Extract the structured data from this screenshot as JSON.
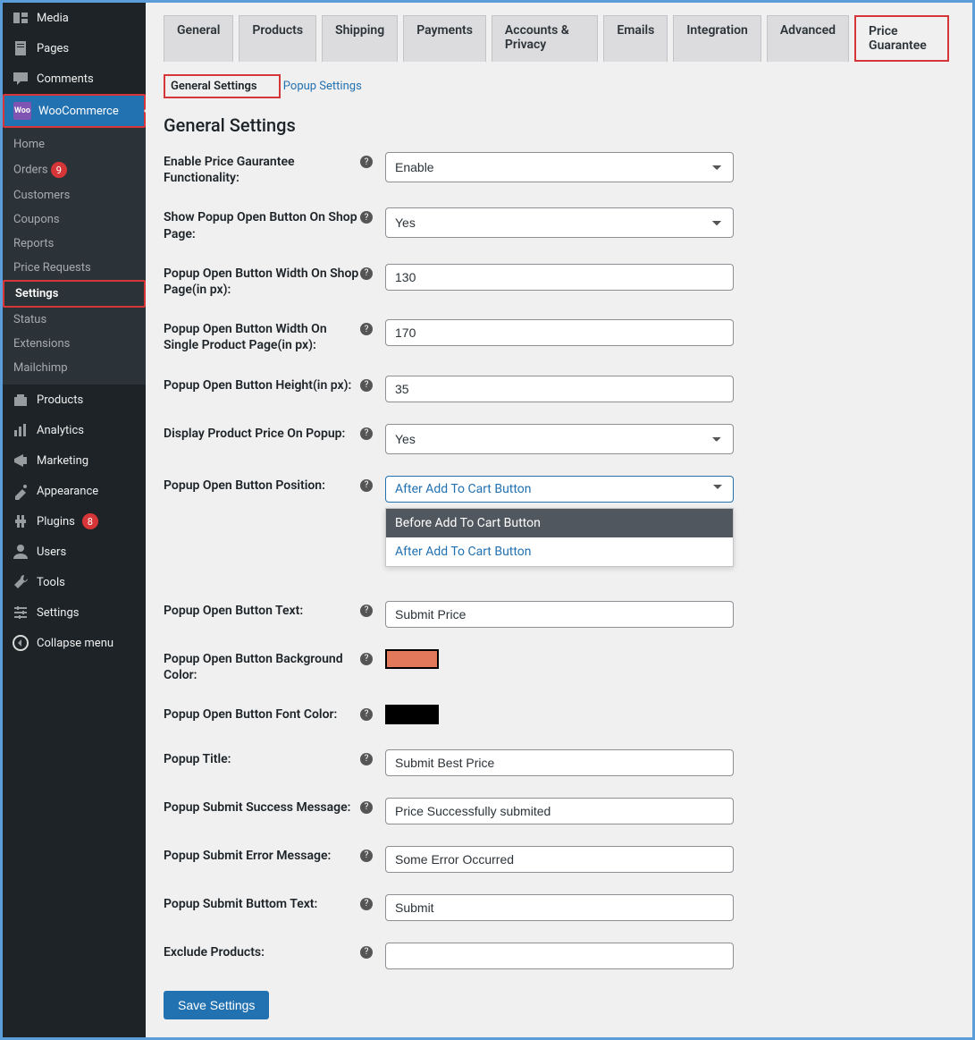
{
  "sidebar": {
    "items": [
      {
        "label": "Media",
        "icon": "media"
      },
      {
        "label": "Pages",
        "icon": "pages"
      },
      {
        "label": "Comments",
        "icon": "comments"
      },
      {
        "label": "WooCommerce",
        "icon": "woo",
        "active": true,
        "frame": true
      },
      {
        "label": "Products",
        "icon": "products"
      },
      {
        "label": "Analytics",
        "icon": "analytics"
      },
      {
        "label": "Marketing",
        "icon": "marketing"
      },
      {
        "label": "Appearance",
        "icon": "appearance"
      },
      {
        "label": "Plugins",
        "icon": "plugins",
        "badge": "8"
      },
      {
        "label": "Users",
        "icon": "users"
      },
      {
        "label": "Tools",
        "icon": "tools"
      },
      {
        "label": "Settings",
        "icon": "settings"
      },
      {
        "label": "Collapse menu",
        "icon": "collapse"
      }
    ],
    "sub": [
      {
        "label": "Home"
      },
      {
        "label": "Orders",
        "badge": "9"
      },
      {
        "label": "Customers"
      },
      {
        "label": "Coupons"
      },
      {
        "label": "Reports"
      },
      {
        "label": "Price Requests"
      },
      {
        "label": "Settings",
        "active": true,
        "frame": true
      },
      {
        "label": "Status"
      },
      {
        "label": "Extensions"
      },
      {
        "label": "Mailchimp"
      }
    ]
  },
  "tabs": [
    {
      "label": "General"
    },
    {
      "label": "Products"
    },
    {
      "label": "Shipping"
    },
    {
      "label": "Payments"
    },
    {
      "label": "Accounts & Privacy"
    },
    {
      "label": "Emails"
    },
    {
      "label": "Integration"
    },
    {
      "label": "Advanced"
    },
    {
      "label": "Price Guarantee",
      "active": true,
      "frame": true
    }
  ],
  "subtabs": [
    {
      "label": "General Settings",
      "active": true,
      "frame": true
    },
    {
      "label": "Popup Settings"
    }
  ],
  "heading": "General Settings",
  "fields": [
    {
      "label": "Enable Price Gaurantee Functionality:",
      "type": "select",
      "value": "Enable"
    },
    {
      "label": "Show Popup Open Button On Shop Page:",
      "type": "select",
      "value": "Yes"
    },
    {
      "label": "Popup Open Button Width On Shop Page(in px):",
      "type": "text",
      "value": "130"
    },
    {
      "label": "Popup Open Button Width On Single Product Page(in px):",
      "type": "text",
      "value": "170"
    },
    {
      "label": "Popup Open Button Height(in px):",
      "type": "text",
      "value": "35"
    },
    {
      "label": "Display Product Price On Popup:",
      "type": "select",
      "value": "Yes"
    },
    {
      "label": "Popup Open Button Position:",
      "type": "dropdown",
      "value": "After Add To Cart Button",
      "options": [
        "Before Add To Cart Button",
        "After Add To Cart Button"
      ]
    },
    {
      "label": "Popup Open Button Text:",
      "type": "text",
      "value": "Submit Price"
    },
    {
      "label": "Popup Open Button Background Color:",
      "type": "color",
      "value": "#e2795b"
    },
    {
      "label": "Popup Open Button Font Color:",
      "type": "color",
      "value": "#000000"
    },
    {
      "label": "Popup Title:",
      "type": "text",
      "value": "Submit Best Price"
    },
    {
      "label": "Popup Submit Success Message:",
      "type": "text",
      "value": "Price Successfully submited"
    },
    {
      "label": "Popup Submit Error Message:",
      "type": "text",
      "value": "Some Error Occurred"
    },
    {
      "label": "Popup Submit Buttom Text:",
      "type": "text",
      "value": "Submit"
    },
    {
      "label": "Exclude Products:",
      "type": "text",
      "value": ""
    }
  ],
  "save": "Save Settings"
}
